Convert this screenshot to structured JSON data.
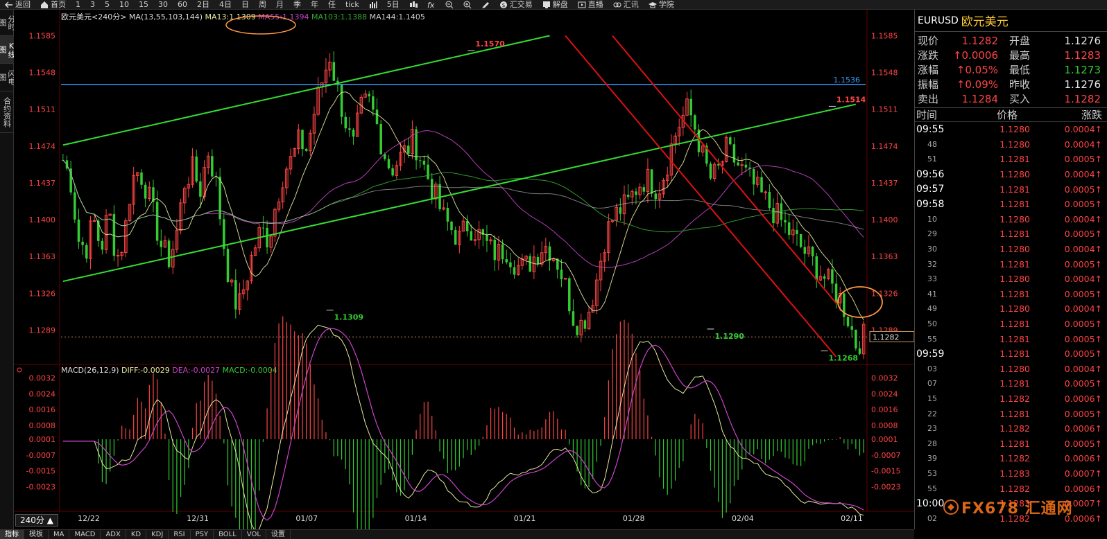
{
  "toolbar": {
    "items": [
      {
        "label": "返回",
        "icon": "back-arrow-icon"
      },
      {
        "label": "首页",
        "icon": "home-icon"
      },
      {
        "label": "1"
      },
      {
        "label": "3"
      },
      {
        "label": "5"
      },
      {
        "label": "10"
      },
      {
        "label": "15"
      },
      {
        "label": "30"
      },
      {
        "label": "60"
      },
      {
        "label": "2日"
      },
      {
        "label": "4日"
      },
      {
        "label": "日"
      },
      {
        "label": "周"
      },
      {
        "label": "月"
      },
      {
        "label": "季"
      },
      {
        "label": "年"
      },
      {
        "label": "任"
      },
      {
        "label": "tick"
      },
      {
        "label": "",
        "icon": "bar-chart-icon"
      },
      {
        "label": "5日"
      },
      {
        "label": "",
        "icon": "candles-icon"
      },
      {
        "label": "",
        "icon": "fx-icon"
      },
      {
        "label": "",
        "icon": "zoom-out-icon"
      },
      {
        "label": "",
        "icon": "zoom-in-icon"
      },
      {
        "label": "",
        "icon": "pen-icon"
      },
      {
        "label": "汇交易",
        "icon": "dollar-icon"
      },
      {
        "label": "解盘",
        "icon": "monitor-icon"
      },
      {
        "label": "直播",
        "icon": "live-icon"
      },
      {
        "label": "汇讯",
        "icon": "link-icon"
      },
      {
        "label": "学院",
        "icon": "graduation-icon"
      }
    ]
  },
  "left_tabs": [
    "分时图",
    "K线图",
    "闪电图",
    "合约资料"
  ],
  "left_tabs_active": 1,
  "period_button": "240分 ▲",
  "bottom_tabs": [
    "指标",
    "模板",
    "MA",
    "MACD",
    "ADX",
    "KD",
    "KDJ",
    "RSI",
    "PSY",
    "BOLL",
    "VOL",
    "设置"
  ],
  "bottom_tabs_active": 0,
  "right_panel": {
    "code": "EURUSD",
    "name": "欧元美元",
    "quote": [
      {
        "l1": "现价",
        "v1": "1.1282",
        "c1": "red",
        "l2": "开盘",
        "v2": "1.1276",
        "c2": "white"
      },
      {
        "l1": "涨跌",
        "v1": "↑0.0006",
        "c1": "red",
        "l2": "最高",
        "v2": "1.1283",
        "c2": "red"
      },
      {
        "l1": "涨幅",
        "v1": "↑0.05%",
        "c1": "red",
        "l2": "最低",
        "v2": "1.1273",
        "c2": "green"
      },
      {
        "l1": "振幅",
        "v1": "↑0.09%",
        "c1": "red",
        "l2": "昨收",
        "v2": "1.1276",
        "c2": "white"
      },
      {
        "l1": "卖出",
        "v1": "1.1284",
        "c1": "red",
        "l2": "买入",
        "v2": "1.1282",
        "c2": "red"
      }
    ],
    "table_headers": [
      "时间",
      "价格",
      "涨跌"
    ],
    "ticks": [
      {
        "t": "09:55",
        "major": true,
        "p": "1.1280",
        "d": "0.0004↑"
      },
      {
        "t": "48",
        "major": false,
        "p": "1.1280",
        "d": "0.0004↑"
      },
      {
        "t": "51",
        "major": false,
        "p": "1.1281",
        "d": "0.0005↑"
      },
      {
        "t": "09:56",
        "major": true,
        "p": "1.1280",
        "d": "0.0004↑"
      },
      {
        "t": "09:57",
        "major": true,
        "p": "1.1281",
        "d": "0.0005↑"
      },
      {
        "t": "09:58",
        "major": true,
        "p": "1.1281",
        "d": "0.0005↑"
      },
      {
        "t": "10",
        "major": false,
        "p": "1.1280",
        "d": "0.0004↑"
      },
      {
        "t": "29",
        "major": false,
        "p": "1.1281",
        "d": "0.0005↑"
      },
      {
        "t": "30",
        "major": false,
        "p": "1.1280",
        "d": "0.0004↑"
      },
      {
        "t": "32",
        "major": false,
        "p": "1.1281",
        "d": "0.0005↑"
      },
      {
        "t": "33",
        "major": false,
        "p": "1.1280",
        "d": "0.0004↑"
      },
      {
        "t": "41",
        "major": false,
        "p": "1.1281",
        "d": "0.0005↑"
      },
      {
        "t": "49",
        "major": false,
        "p": "1.1280",
        "d": "0.0004↑"
      },
      {
        "t": "50",
        "major": false,
        "p": "1.1281",
        "d": "0.0005↑"
      },
      {
        "t": "55",
        "major": false,
        "p": "1.1281",
        "d": "0.0005↑"
      },
      {
        "t": "09:59",
        "major": true,
        "p": "1.1281",
        "d": "0.0005↑"
      },
      {
        "t": "03",
        "major": false,
        "p": "1.1280",
        "d": "0.0004↑"
      },
      {
        "t": "07",
        "major": false,
        "p": "1.1281",
        "d": "0.0005↑"
      },
      {
        "t": "15",
        "major": false,
        "p": "1.1282",
        "d": "0.0006↑"
      },
      {
        "t": "22",
        "major": false,
        "p": "1.1281",
        "d": "0.0005↑"
      },
      {
        "t": "23",
        "major": false,
        "p": "1.1282",
        "d": "0.0006↑"
      },
      {
        "t": "28",
        "major": false,
        "p": "1.1281",
        "d": "0.0005↑"
      },
      {
        "t": "39",
        "major": false,
        "p": "1.1282",
        "d": "0.0006↑"
      },
      {
        "t": "53",
        "major": false,
        "p": "1.1283",
        "d": "0.0007↑"
      },
      {
        "t": "55",
        "major": false,
        "p": "1.1282",
        "d": "0.0006↑"
      },
      {
        "t": "10:00",
        "major": true,
        "p": "1.1283",
        "d": "0.0007↑"
      },
      {
        "t": "02",
        "major": false,
        "p": "1.1282",
        "d": "0.0006↑"
      }
    ]
  },
  "watermark": "FX678 汇通网",
  "colors": {
    "up": "#ff4444",
    "down": "#33cc33",
    "ma13": "#e8e8a0",
    "ma55": "#cc44cc",
    "ma103": "#33aa33",
    "ma144": "#cccccc",
    "trend_green": "#33dd33",
    "trend_red": "#dd1111",
    "hline": "#3399ff",
    "annot": "#ff9944"
  },
  "chart_data": [
    {
      "type": "candlestick",
      "title": "欧元美元<240分>",
      "legend_label": "MA(13,55,103,144)",
      "ma_values": [
        {
          "name": "MA13",
          "value": "1.1309"
        },
        {
          "name": "MA55",
          "value": "1.1394"
        },
        {
          "name": "MA103",
          "value": "1.1388"
        },
        {
          "name": "MA144",
          "value": "1.1405"
        }
      ],
      "y_ticks": [
        1.1585,
        1.1548,
        1.1511,
        1.1474,
        1.1437,
        1.14,
        1.1363,
        1.1326,
        1.1289
      ],
      "ylim": [
        1.126,
        1.16
      ],
      "x_ticks": [
        "12/22",
        "12/31",
        "01/07",
        "01/14",
        "01/21",
        "01/28",
        "02/04",
        "02/11"
      ],
      "last_price": "1.1282",
      "horizontal_line": {
        "value": 1.1536,
        "label": "1.1536"
      },
      "annotations": [
        {
          "text": "1.1570",
          "value": 1.157,
          "color": "red"
        },
        {
          "text": "1.1514",
          "value": 1.1514,
          "color": "red"
        },
        {
          "text": "1.1309",
          "value": 1.1309,
          "color": "green"
        },
        {
          "text": "1.1290",
          "value": 1.129,
          "color": "green"
        },
        {
          "text": "1.1268",
          "value": 1.1268,
          "color": "green"
        }
      ],
      "trend_lines": [
        {
          "color": "green",
          "from": {
            "bar": 0,
            "v": 1.1475
          },
          "to": {
            "bar": 124,
            "v": 1.1585
          }
        },
        {
          "color": "green",
          "from": {
            "bar": 0,
            "v": 1.1338
          },
          "to": {
            "bar": 202,
            "v": 1.1516
          }
        },
        {
          "color": "red",
          "from": {
            "bar": 128,
            "v": 1.1585
          },
          "to": {
            "bar": 197,
            "v": 1.1262
          }
        },
        {
          "color": "red",
          "from": {
            "bar": 140,
            "v": 1.1585
          },
          "to": {
            "bar": 197,
            "v": 1.1316
          }
        }
      ],
      "price_path": [
        1.146,
        1.144,
        1.138,
        1.137,
        1.14,
        1.137,
        1.141,
        1.136,
        1.138,
        1.144,
        1.145,
        1.143,
        1.14,
        1.137,
        1.136,
        1.139,
        1.144,
        1.145,
        1.143,
        1.147,
        1.144,
        1.138,
        1.133,
        1.131,
        1.134,
        1.137,
        1.139,
        1.138,
        1.142,
        1.145,
        1.146,
        1.148,
        1.147,
        1.151,
        1.154,
        1.1565,
        1.153,
        1.15,
        1.147,
        1.151,
        1.152,
        1.15,
        1.147,
        1.145,
        1.146,
        1.147,
        1.148,
        1.146,
        1.144,
        1.142,
        1.14,
        1.139,
        1.138,
        1.1395,
        1.139,
        1.138,
        1.137,
        1.1365,
        1.1372,
        1.136,
        1.135,
        1.1355,
        1.1365,
        1.1375,
        1.137,
        1.1355,
        1.133,
        1.13,
        1.1295,
        1.131,
        1.134,
        1.138,
        1.14,
        1.141,
        1.1415,
        1.143,
        1.144,
        1.144,
        1.143,
        1.145,
        1.148,
        1.15,
        1.1512,
        1.149,
        1.146,
        1.144,
        1.145,
        1.147,
        1.146,
        1.145,
        1.144,
        1.143,
        1.142,
        1.141,
        1.14,
        1.139,
        1.138,
        1.137,
        1.136,
        1.135,
        1.134,
        1.133,
        1.132,
        1.13,
        1.1275,
        1.1282
      ]
    },
    {
      "type": "macd",
      "legend_label": "MACD(26,12,9)",
      "diff_label": "DIFF:-0.0029",
      "dea_label": "DEA:-0.0027",
      "macd_label": "MACD:-0.0004",
      "y_ticks": [
        0.0032,
        0.0024,
        0.0016,
        0.0008,
        0.0001,
        -0.0007,
        -0.0015,
        -0.0023
      ],
      "ylim": [
        -0.0034,
        0.0036
      ]
    }
  ]
}
